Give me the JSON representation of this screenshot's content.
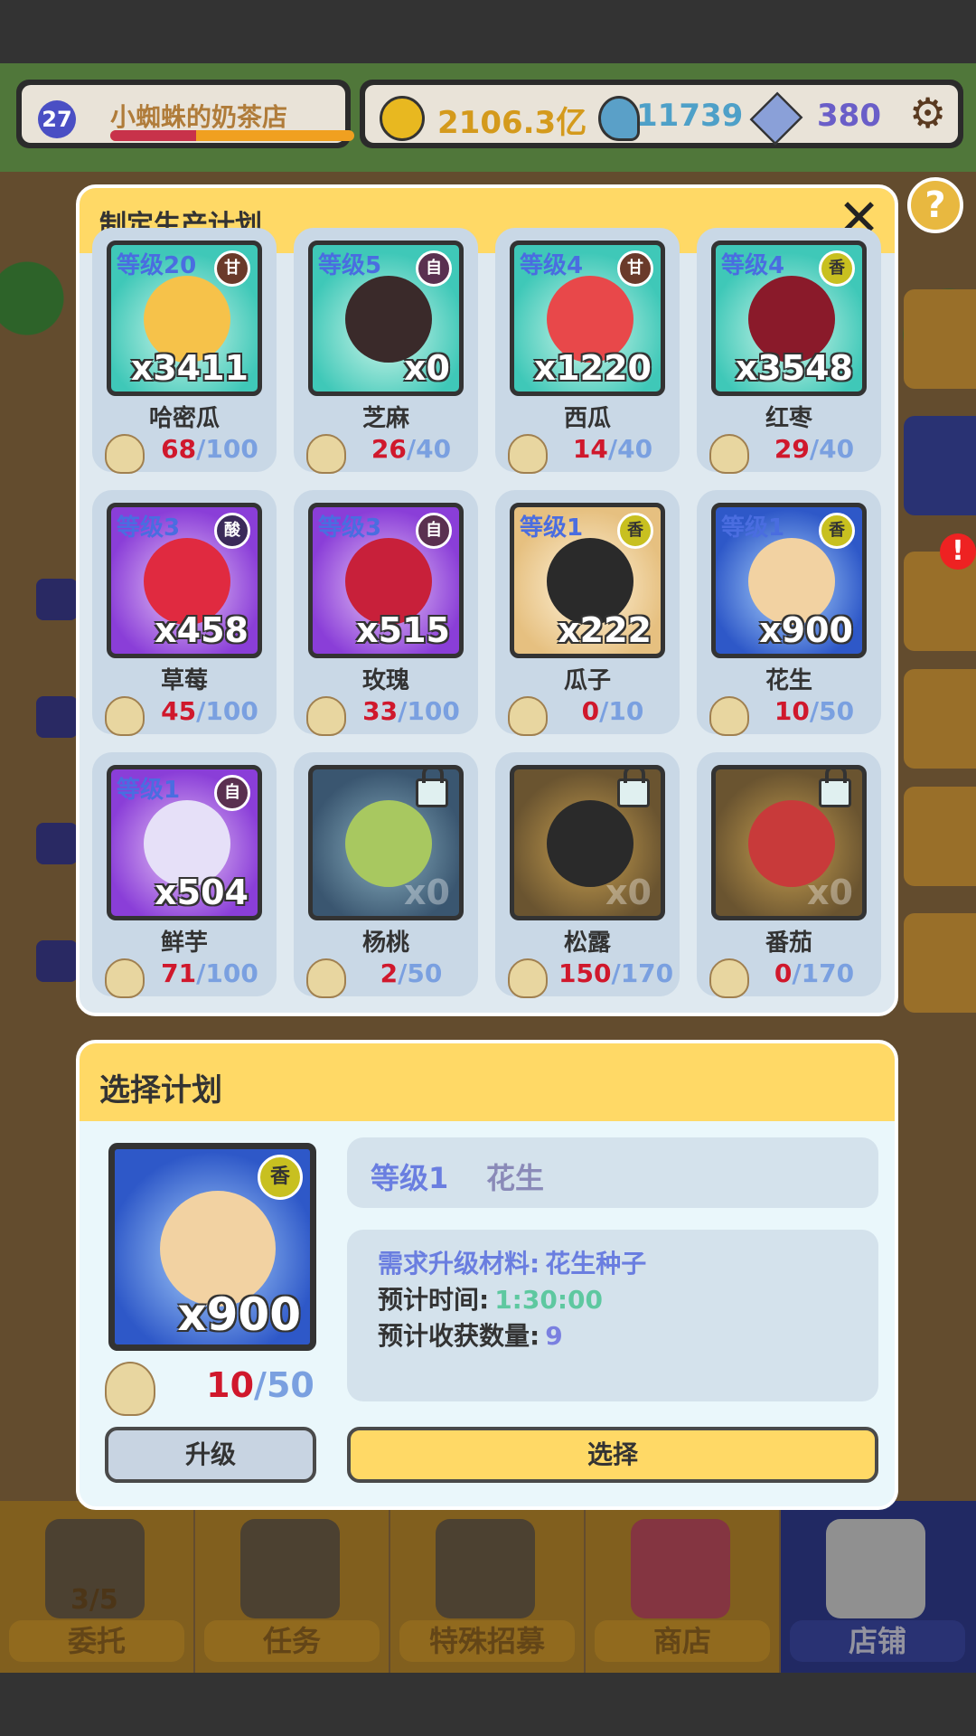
{
  "hud": {
    "level": "27",
    "shop_name": "小蜘蛛的奶茶店",
    "xp_progress": 0.35,
    "coins": "2106.3亿",
    "gems": "11739",
    "crystals": "380",
    "settings_icon": "gear-icon"
  },
  "panel": {
    "title": "制定生产计划",
    "close_icon": "close-icon",
    "items": [
      {
        "level": "等级20",
        "tag": "甘",
        "count": "x3411",
        "name": "哈密瓜",
        "cur": "68",
        "max": "100",
        "bg": "teal",
        "color": "#f6c24a",
        "locked": false
      },
      {
        "level": "等级5",
        "tag": "自",
        "count": "x0",
        "name": "芝麻",
        "cur": "26",
        "max": "40",
        "bg": "teal",
        "color": "#3a2a2a",
        "locked": false
      },
      {
        "level": "等级4",
        "tag": "甘",
        "count": "x1220",
        "name": "西瓜",
        "cur": "14",
        "max": "40",
        "bg": "teal",
        "color": "#e8484a",
        "locked": false
      },
      {
        "level": "等级4",
        "tag": "香",
        "count": "x3548",
        "name": "红枣",
        "cur": "29",
        "max": "40",
        "bg": "teal",
        "color": "#8a1a2a",
        "locked": false
      },
      {
        "level": "等级3",
        "tag": "酸",
        "count": "x458",
        "name": "草莓",
        "cur": "45",
        "max": "100",
        "bg": "purple",
        "color": "#e02a40",
        "locked": false
      },
      {
        "level": "等级3",
        "tag": "自",
        "count": "x515",
        "name": "玫瑰",
        "cur": "33",
        "max": "100",
        "bg": "purple",
        "color": "#c8203a",
        "locked": false
      },
      {
        "level": "等级1",
        "tag": "香",
        "count": "x222",
        "name": "瓜子",
        "cur": "0",
        "max": "10",
        "bg": "sand",
        "color": "#2a2a2a",
        "locked": false
      },
      {
        "level": "等级1",
        "tag": "香",
        "count": "x900",
        "name": "花生",
        "cur": "10",
        "max": "50",
        "bg": "blue",
        "color": "#f2d2a2",
        "locked": false
      },
      {
        "level": "等级1",
        "tag": "自",
        "count": "x504",
        "name": "鲜芋",
        "cur": "71",
        "max": "100",
        "bg": "purple",
        "color": "#e6e0f8",
        "locked": false
      },
      {
        "level": "",
        "tag": "",
        "count": "x0",
        "name": "杨桃",
        "cur": "2",
        "max": "50",
        "bg": "locked-a",
        "color": "#a8c860",
        "locked": true
      },
      {
        "level": "",
        "tag": "",
        "count": "x0",
        "name": "松露",
        "cur": "150",
        "max": "170",
        "bg": "locked-b",
        "color": "#2a2a2a",
        "locked": true
      },
      {
        "level": "",
        "tag": "",
        "count": "x0",
        "name": "番茄",
        "cur": "0",
        "max": "170",
        "bg": "locked-b",
        "color": "#c83a3a",
        "locked": true
      }
    ]
  },
  "plan": {
    "title": "选择计划",
    "level": "等级1",
    "name": "花生",
    "tag": "香",
    "count": "x900",
    "cur": "10",
    "max": "50",
    "material_label": "需求升级材料:",
    "material_value": "花生种子",
    "time_label": "预计时间:",
    "time_value": "1:30:00",
    "yield_label": "预计收获数量:",
    "yield_value": "9",
    "upgrade_label": "升级",
    "select_label": "选择"
  },
  "nav": [
    {
      "label": "委托",
      "badge": "3/5"
    },
    {
      "label": "任务",
      "badge": ""
    },
    {
      "label": "特殊招募",
      "badge": ""
    },
    {
      "label": "商店",
      "badge": ""
    },
    {
      "label": "店铺",
      "badge": ""
    }
  ]
}
